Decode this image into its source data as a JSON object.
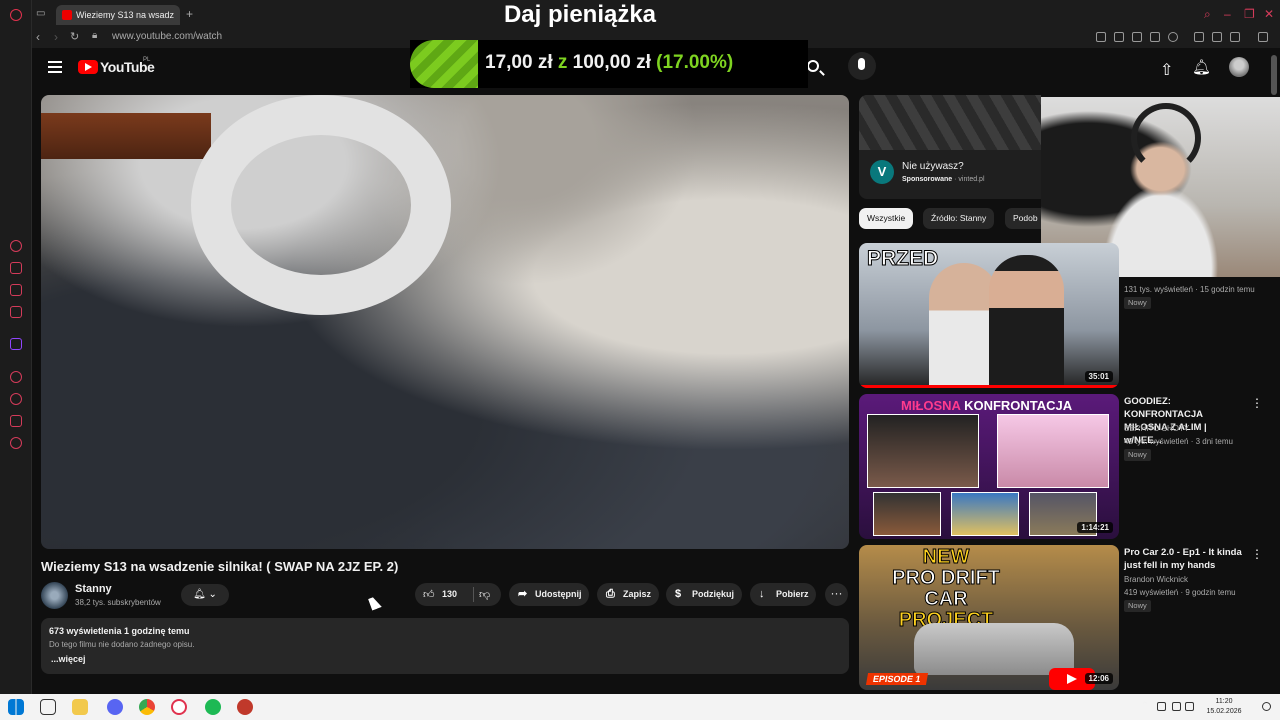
{
  "browser": {
    "tab_title": "Wieziemy S13 na wsadz",
    "url": "www.youtube.com/watch"
  },
  "stream_overlay": {
    "title": "Daj pieniążka",
    "donation_current": "17,00 zł",
    "donation_connector": "z",
    "donation_goal": "100,00 zł",
    "donation_percent": "(17.00%)",
    "progress_fraction": 0.17
  },
  "youtube": {
    "logo_text": "YouTube",
    "logo_country": "PL"
  },
  "video": {
    "title": "Wieziemy S13 na wsadzenie silnika! ( SWAP NA 2JZ EP. 2)",
    "channel_name": "Stanny",
    "subscribers": "38,2 tys. subskrybentów",
    "likes": "130",
    "actions": {
      "share": "Udostępnij",
      "save": "Zapisz",
      "thanks": "Podziękuj",
      "download": "Pobierz"
    },
    "description": {
      "stats": "673 wyświetlenia  1 godzinę temu",
      "text": "Do tego filmu nie dodano żadnego opisu.",
      "more": "...więcej"
    }
  },
  "ad": {
    "logo_letter": "V",
    "title": "Nie używasz?",
    "sponsored": "Sponsorowane",
    "domain": "vinted.pl"
  },
  "chips": [
    "Wszystkie",
    "Źródło: Stanny",
    "Podob"
  ],
  "recommendations": [
    {
      "thumb_text": "PRZED",
      "duration": "35:01",
      "meta": "131 tys. wyświetleń · 15 godzin temu",
      "badge": "Nowy"
    },
    {
      "thumb_heading_a": "MIŁOSNA",
      "thumb_heading_b": " KONFRONTACJA",
      "title": "GOODIEZ: KONFRONTACJA MIŁOSNA Z ALIM | w/NEE...",
      "channel": "SERHITO SHOTY",
      "meta": "42 tys. wyświetleń · 3 dni temu",
      "badge": "Nowy",
      "duration": "1:14:21"
    },
    {
      "thumb_line1": "NEW",
      "thumb_line2": "PRO DRIFT CAR",
      "thumb_line3": "PROJECT",
      "thumb_episode": "EPISODE 1",
      "title": "Pro Car 2.0 - Ep1 - It kinda just fell in my hands",
      "channel": "Brandon Wicknick",
      "meta": "419 wyświetleń · 9 godzin temu",
      "badge": "Nowy",
      "duration": "12:06"
    }
  ],
  "taskbar": {
    "time": "11:20",
    "date": "15.02.2026"
  },
  "colors": {
    "youtube_red": "#ff0000",
    "donation_green": "#7ed321",
    "opera_red": "#d43b5a",
    "vinted_teal": "#09787c"
  }
}
